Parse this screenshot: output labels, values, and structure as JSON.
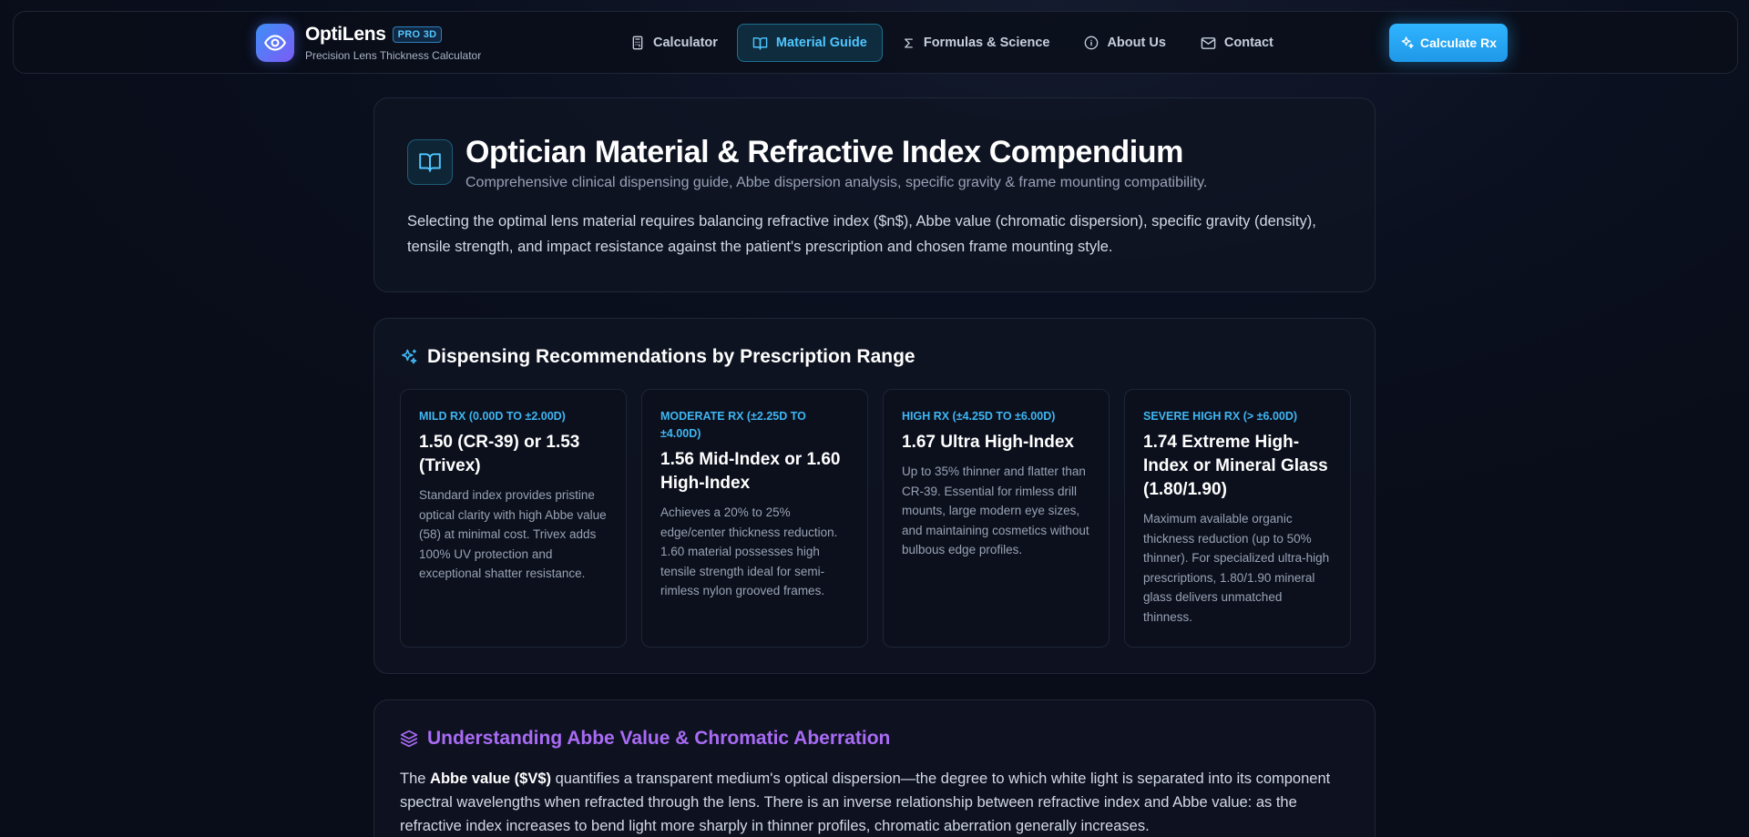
{
  "brand": {
    "name": "OptiLens",
    "badge": "PRO 3D",
    "subtitle": "Precision Lens Thickness Calculator",
    "logo_icon": "eye-icon"
  },
  "nav": {
    "items": [
      {
        "label": "Calculator",
        "icon": "calculator-icon",
        "active": false
      },
      {
        "label": "Material Guide",
        "icon": "book-open-icon",
        "active": true
      },
      {
        "label": "Formulas & Science",
        "icon": "sigma-icon",
        "active": false
      },
      {
        "label": "About Us",
        "icon": "info-icon",
        "active": false
      },
      {
        "label": "Contact",
        "icon": "mail-icon",
        "active": false
      }
    ],
    "cta_label": "Calculate Rx"
  },
  "hero": {
    "title": "Optician Material & Refractive Index Compendium",
    "subtitle": "Comprehensive clinical dispensing guide, Abbe dispersion analysis, specific gravity & frame mounting compatibility.",
    "description": "Selecting the optimal lens material requires balancing refractive index ($n$), Abbe value (chromatic dispersion), specific gravity (density), tensile strength, and impact resistance against the patient's prescription and chosen frame mounting style."
  },
  "recommendations": {
    "title": "Dispensing Recommendations by Prescription Range",
    "cards": [
      {
        "range": "Mild Rx (0.00D to ±2.00D)",
        "material": "1.50 (CR-39) or 1.53 (Trivex)",
        "description": "Standard index provides pristine optical clarity with high Abbe value (58) at minimal cost. Trivex adds 100% UV protection and exceptional shatter resistance."
      },
      {
        "range": "Moderate Rx (±2.25D to ±4.00D)",
        "material": "1.56 Mid-Index or 1.60 High-Index",
        "description": "Achieves a 20% to 25% edge/center thickness reduction. 1.60 material possesses high tensile strength ideal for semi-rimless nylon grooved frames."
      },
      {
        "range": "High Rx (±4.25D to ±6.00D)",
        "material": "1.67 Ultra High-Index",
        "description": "Up to 35% thinner and flatter than CR-39. Essential for rimless drill mounts, large modern eye sizes, and maintaining cosmetics without bulbous edge profiles."
      },
      {
        "range": "Severe High Rx (> ±6.00D)",
        "material": "1.74 Extreme High-Index or Mineral Glass (1.80/1.90)",
        "description": "Maximum available organic thickness reduction (up to 50% thinner). For specialized ultra-high prescriptions, 1.80/1.90 mineral glass delivers unmatched thinness."
      }
    ]
  },
  "abbe": {
    "title": "Understanding Abbe Value & Chromatic Aberration",
    "text_prefix": "The ",
    "text_bold": "Abbe value ($V$)",
    "text_rest": " quantifies a transparent medium's optical dispersion—the degree to which white light is separated into its component spectral wavelengths when refracted through the lens. There is an inverse relationship between refractive index and Abbe value: as the refractive index increases to bend light more sharply in thinner profiles, chromatic aberration generally increases."
  },
  "colors": {
    "accent_blue": "#3fb6f2",
    "accent_purple": "#a96bf5",
    "background": "#0b1020"
  }
}
